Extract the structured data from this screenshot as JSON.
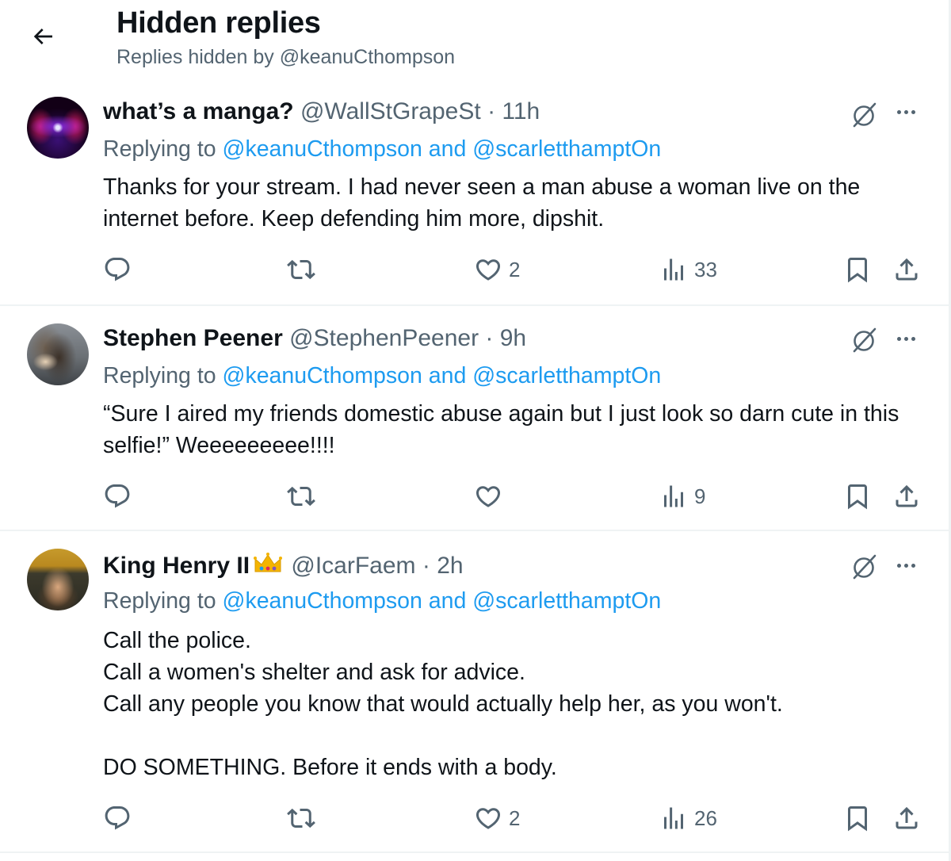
{
  "header": {
    "title": "Hidden replies",
    "subtitle": "Replies hidden by @keanuCthompson",
    "back_icon": "arrow-left-icon"
  },
  "tweets": [
    {
      "name": "what’s a manga?",
      "handle": "@WallStGrapeSt",
      "time": "· 11h",
      "replying_prefix": "Replying to ",
      "mention1": "@keanuCthompson",
      "and": " and ",
      "mention2": "@scarletthamptOn",
      "text": "Thanks for your stream. I had never seen a man abuse a woman live on the internet before. Keep defending him more, dipshit.",
      "replies": "",
      "retweets": "",
      "likes": "2",
      "views": "33"
    },
    {
      "name": "Stephen Peener",
      "handle": "@StephenPeener",
      "time": "· 9h",
      "replying_prefix": "Replying to ",
      "mention1": "@keanuCthompson",
      "and": " and ",
      "mention2": "@scarletthamptOn",
      "text": "“Sure I aired my friends domestic abuse again but I just look so darn cute in this selfie!” Weeeeeeeee!!!!",
      "replies": "",
      "retweets": "",
      "likes": "",
      "views": "9"
    },
    {
      "name": "King Henry II",
      "handle": "@IcarFaem",
      "time": "· 2h",
      "replying_prefix": "Replying to ",
      "mention1": "@keanuCthompson",
      "and": " and ",
      "mention2": "@scarletthamptOn",
      "text": "Call the police.\nCall a women's shelter and ask for advice.\nCall any people you know that would actually help her, as you won't.\n\nDO SOMETHING.  Before it ends with a body.",
      "replies": "",
      "retweets": "",
      "likes": "2",
      "views": "26"
    }
  ],
  "colors": {
    "text": "#0f1419",
    "secondary": "#536471",
    "accent": "#1d9bf0",
    "divider": "#eff3f4"
  }
}
